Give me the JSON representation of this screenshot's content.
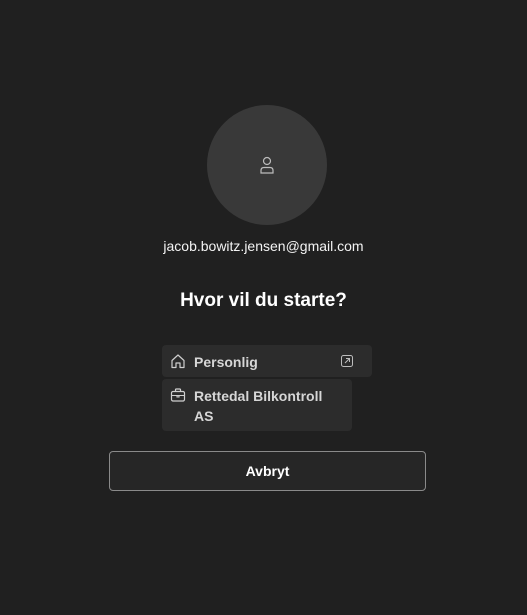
{
  "account": {
    "email": "jacob.bowitz.jensen@gmail.com",
    "avatar_icon": "person-icon"
  },
  "prompt": {
    "heading": "Hvor vil du starte?"
  },
  "options": [
    {
      "label": "Personlig",
      "icon": "home-icon",
      "trailing_icon": "open-external-icon"
    },
    {
      "label": "Rettedal Bilkontroll AS",
      "icon": "briefcase-icon"
    }
  ],
  "actions": {
    "cancel_label": "Avbryt"
  },
  "colors": {
    "background": "#202020",
    "avatar_bg": "#393939",
    "option_bg": "#2c2c2c",
    "button_border": "#8a8a8a"
  }
}
